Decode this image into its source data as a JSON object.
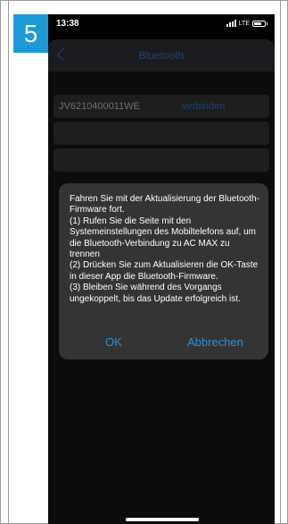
{
  "step": {
    "number": "5",
    "color": "#1b9ad6"
  },
  "status_bar": {
    "time": "13:38",
    "network": "LTE",
    "icons": [
      "signal-icon",
      "battery-icon"
    ]
  },
  "nav": {
    "title": "Bluetooth",
    "back_icon": "chevron-left-icon"
  },
  "device": {
    "name": "JV6210400011WE",
    "action": "verbinden"
  },
  "dialog": {
    "message": "Fahren Sie mit der Aktualisierung der Bluetooth-Firmware fort.\n(1) Rufen Sie die Seite mit den Systemeinstellungen des Mobiltelefons auf, um die Bluetooth-Verbindung zu AC MAX zu trennen\n(2) Drücken Sie zum Aktualisieren die OK-Taste in dieser App die Bluetooth-Firmware.\n(3) Bleiben Sie während des Vorgangs ungekoppelt, bis das Update erfolgreich ist.",
    "ok_label": "OK",
    "cancel_label": "Abbrechen",
    "accent": "#2e8dd6"
  }
}
